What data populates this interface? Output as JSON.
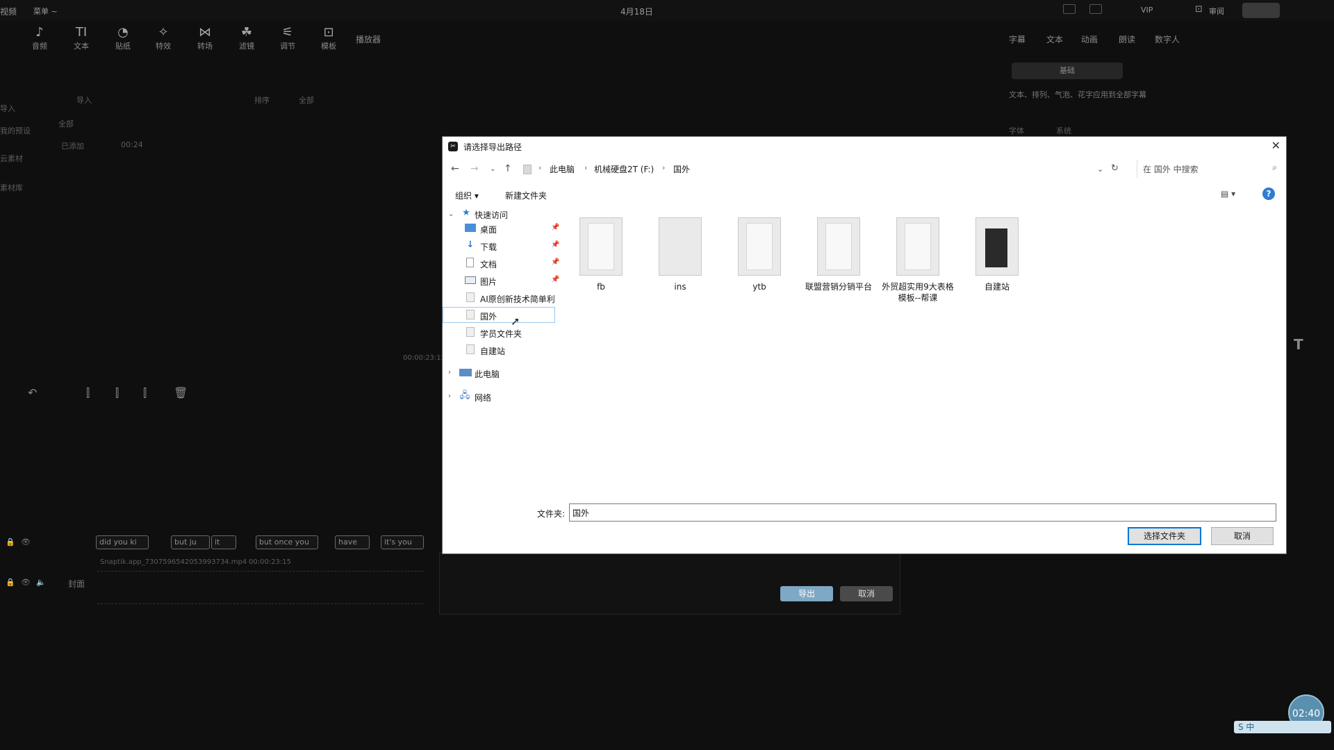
{
  "app": {
    "menu_left": "视频",
    "menu_item": "菜单 ~",
    "title_date": "4月18日",
    "vip": "VIP",
    "review": "审阅",
    "tools": [
      {
        "icon": "audio-icon",
        "label": "音频",
        "glyph": "♪"
      },
      {
        "icon": "text-icon",
        "label": "文本",
        "glyph": "TI"
      },
      {
        "icon": "sticker-icon",
        "label": "贴纸",
        "glyph": "◔"
      },
      {
        "icon": "effects-icon",
        "label": "特效",
        "glyph": "✧"
      },
      {
        "icon": "transition-icon",
        "label": "转场",
        "glyph": "⋈"
      },
      {
        "icon": "filter-icon",
        "label": "滤镜",
        "glyph": "☘"
      },
      {
        "icon": "adjust-icon",
        "label": "调节",
        "glyph": "⚟"
      },
      {
        "icon": "template-icon",
        "label": "模板",
        "glyph": "⊡"
      }
    ],
    "player_label": "播放器",
    "right_tabs": [
      "字幕",
      "文本",
      "动画",
      "朗读",
      "数字人"
    ],
    "left_panel": {
      "import": "导入",
      "sort": "排序",
      "all": "全部",
      "all_tag": "全部",
      "added": "已添加",
      "duration": "00:24",
      "sidebar": [
        "导入",
        "我的预设",
        "云素材",
        "素材库"
      ]
    },
    "right_panel": {
      "preset": "基础",
      "desc": "文本、排列、气泡、花字应用到全部字幕",
      "font_label": "字体",
      "font_value": "系统"
    },
    "timecodes": "00:00:23:15",
    "clips": [
      "did you ki",
      "but ju",
      "it",
      "but once you",
      "have",
      "it's you"
    ],
    "clip_file": "Snaptik.app_7307596542053993734.mp4",
    "clip_time": "00:00:23:15",
    "cover_label": "封面",
    "export_btn": "导出",
    "cancel_btn": "取消",
    "clock": "02:40",
    "ime": "S 中"
  },
  "dialog": {
    "title": "请选择导出路径",
    "breadcrumb": [
      "此电脑",
      "机械硬盘2T (F:)",
      "国外"
    ],
    "search_placeholder": "在 国外 中搜索",
    "organize": "组织 ▾",
    "new_folder": "新建文件夹",
    "quick_access": "快速访问",
    "nav": [
      {
        "icon": "desktop-icon",
        "label": "桌面",
        "pinned": true
      },
      {
        "icon": "download-icon",
        "label": "下载",
        "pinned": true
      },
      {
        "icon": "documents-icon",
        "label": "文档",
        "pinned": true
      },
      {
        "icon": "pictures-icon",
        "label": "图片",
        "pinned": true
      },
      {
        "icon": "folder-icon",
        "label": "AI原创新技术简单利",
        "pinned": false
      },
      {
        "icon": "folder-icon",
        "label": "国外",
        "pinned": false
      },
      {
        "icon": "folder-icon",
        "label": "学员文件夹",
        "pinned": false
      },
      {
        "icon": "folder-icon",
        "label": "自建站",
        "pinned": false
      }
    ],
    "this_pc": "此电脑",
    "network": "网络",
    "folders": [
      {
        "name": "fb",
        "style": "plain"
      },
      {
        "name": "ins",
        "style": "plain"
      },
      {
        "name": "ytb",
        "style": "plain"
      },
      {
        "name": "联盟营销分销平台",
        "style": "plain"
      },
      {
        "name": "外贸超实用9大表格模板--帮课",
        "style": "paper"
      },
      {
        "name": "自建站",
        "style": "dark"
      }
    ],
    "folder_label": "文件夹:",
    "folder_value": "国外",
    "select_btn": "选择文件夹",
    "cancel_btn": "取消"
  }
}
